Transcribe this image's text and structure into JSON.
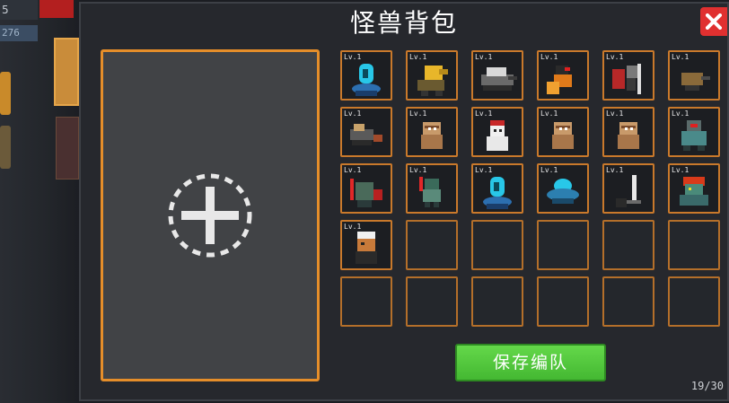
{
  "background": {
    "stat_top": "5",
    "stat_value": "276"
  },
  "modal": {
    "title": "怪兽背包",
    "save_label": "保存编队",
    "counter": "19/30"
  },
  "grid": {
    "level_label": "Lv.1",
    "filled": [
      {
        "icon": "blue-capsule-monster-icon"
      },
      {
        "icon": "yellow-cannon-monster-icon"
      },
      {
        "icon": "gatling-tank-monster-icon"
      },
      {
        "icon": "fire-crow-monster-icon"
      },
      {
        "icon": "sword-knight-monster-icon"
      },
      {
        "icon": "small-turret-monster-icon"
      },
      {
        "icon": "turret-gunner-monster-icon"
      },
      {
        "icon": "mummy-monster-icon"
      },
      {
        "icon": "snowman-monster-icon"
      },
      {
        "icon": "mummy-monster-icon"
      },
      {
        "icon": "mummy-monster-icon"
      },
      {
        "icon": "armored-robot-monster-icon"
      },
      {
        "icon": "red-blade-robot-monster-icon"
      },
      {
        "icon": "green-robot-monster-icon"
      },
      {
        "icon": "blue-capsule-monster-icon"
      },
      {
        "icon": "ufo-monster-icon"
      },
      {
        "icon": "sword-monster-icon"
      },
      {
        "icon": "red-hair-goblin-monster-icon"
      },
      {
        "icon": "tribal-warrior-monster-icon"
      }
    ],
    "total_slots": 30
  },
  "colors": {
    "slot_border": "#e58e2a",
    "save_button": "#4cc236",
    "close_button": "#e03030"
  }
}
